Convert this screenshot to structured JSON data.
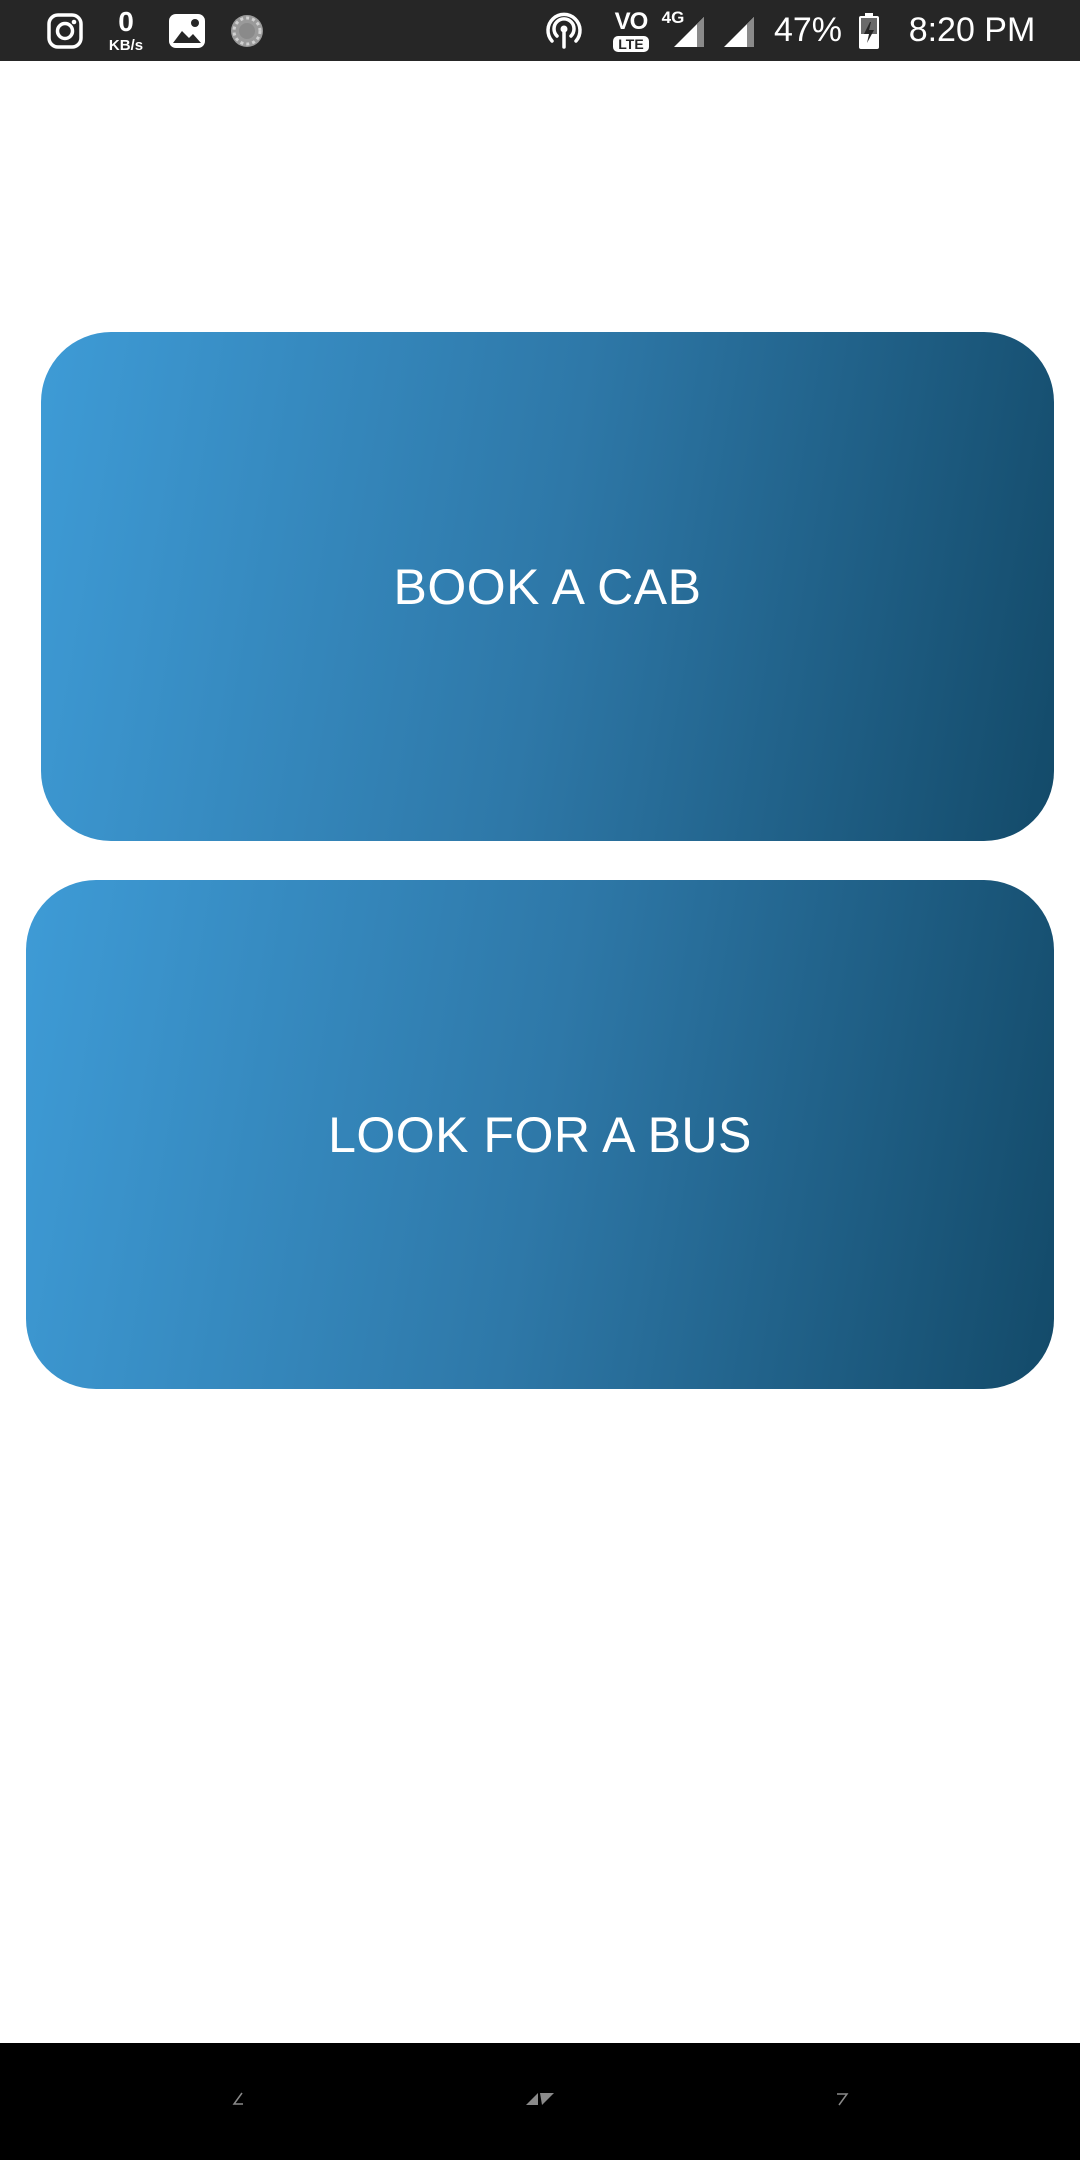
{
  "status_bar": {
    "net_speed_value": "0",
    "net_speed_unit": "KB/s",
    "volte_top": "VO",
    "volte_badge": "LTE",
    "network_type": "4G",
    "battery_percent": "47%",
    "time": "8:20 PM",
    "icons": [
      "instagram-icon",
      "gallery-icon",
      "loading-icon",
      "hotspot-icon",
      "signal-icon",
      "signal-icon",
      "battery-charging-icon"
    ]
  },
  "main": {
    "book_cab_label": "BOOK A CAB",
    "bus_label": "LOOK FOR A BUS"
  },
  "colors": {
    "status_bar_bg": "#262626",
    "button_gradient_start": "#3E9BD6",
    "button_gradient_end": "#134A69",
    "nav_bar_bg": "#000000"
  },
  "nav_bar": {
    "icons": [
      "nav-back-icon",
      "nav-home-icon",
      "nav-recents-icon"
    ]
  }
}
